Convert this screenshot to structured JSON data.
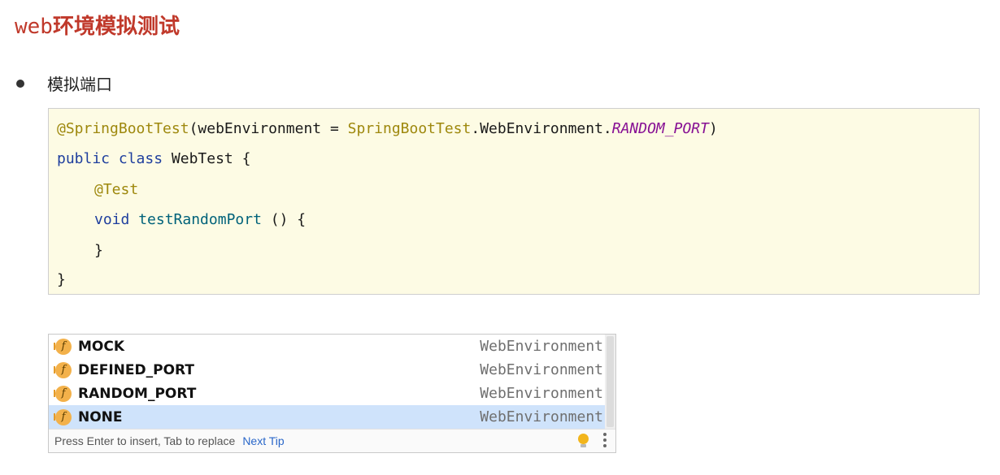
{
  "heading": {
    "prefix": "web",
    "rest": "环境模拟测试"
  },
  "bullet": {
    "text": "模拟端口"
  },
  "code": {
    "l1": {
      "annotation": "@SpringBootTest",
      "open": "(webEnvironment = ",
      "cls": "SpringBootTest",
      "mid": ".WebEnvironment.",
      "const": "RANDOM_PORT",
      "close": ")"
    },
    "l2": {
      "kw1": "public",
      "kw2": "class",
      "rest": " WebTest {"
    },
    "l3": {
      "annotation": "@Test"
    },
    "l4": {
      "kw": "void",
      "fn": "testRandomPort",
      "rest": " () {"
    },
    "l5": {
      "text": "}"
    },
    "l6": {
      "text": "}"
    }
  },
  "completion": {
    "items": [
      {
        "name": "MOCK",
        "type": "WebEnvironment"
      },
      {
        "name": "DEFINED_PORT",
        "type": "WebEnvironment"
      },
      {
        "name": "RANDOM_PORT",
        "type": "WebEnvironment"
      },
      {
        "name": "NONE",
        "type": "WebEnvironment"
      }
    ],
    "selected_index": 3,
    "icon_letter": "f",
    "hint": "Press Enter to insert, Tab to replace",
    "next_tip": "Next Tip"
  },
  "colors": {
    "heading": "#c0392b",
    "code_bg": "#fdfbe4",
    "selection": "#cfe3fb",
    "link": "#2a67c9"
  },
  "icons": {
    "completion_item": "field-icon",
    "tip": "lightbulb-icon",
    "menu": "more-vertical-icon"
  }
}
